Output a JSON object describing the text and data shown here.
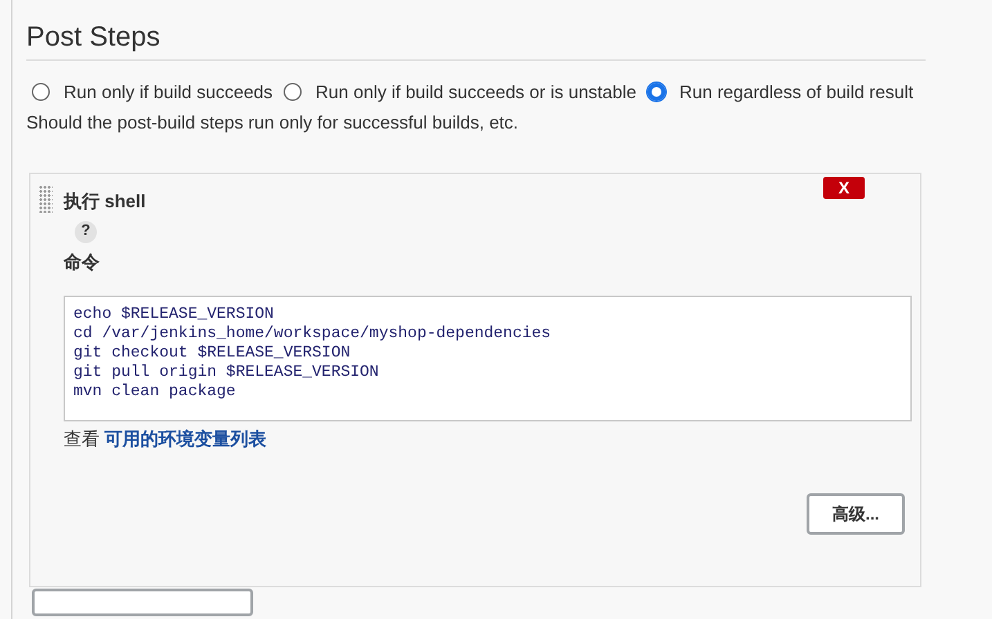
{
  "section": {
    "title": "Post Steps"
  },
  "options": [
    {
      "label": "Run only if build succeeds",
      "selected": false
    },
    {
      "label": "Run only if build succeeds or is unstable",
      "selected": false
    },
    {
      "label": "Run regardless of build result",
      "selected": true
    }
  ],
  "description": "Should the post-build steps run only for successful builds, etc.",
  "step": {
    "title": "执行 shell",
    "delete_label": "X",
    "help": "?",
    "field_label": "命令",
    "command_lines": [
      "echo $RELEASE_VERSION",
      "cd /var/jenkins_home/workspace/myshop-dependencies",
      "git checkout $RELEASE_VERSION",
      "git pull origin $RELEASE_VERSION",
      "mvn clean package"
    ],
    "env_prefix": "查看",
    "env_link": "可用的环境变量列表",
    "advanced_button": "高级..."
  }
}
